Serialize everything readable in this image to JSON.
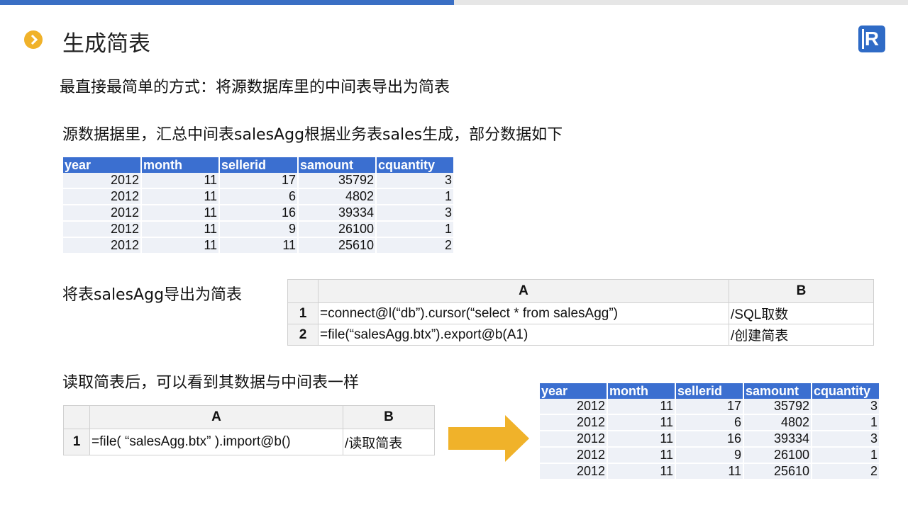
{
  "header": {
    "title": "生成简表",
    "progress": 0.5
  },
  "colors": {
    "accent": "#3a6fc4",
    "bullet": "#f0b22a",
    "arrow": "#f0b22a",
    "table_header": "#3b6fd0"
  },
  "texts": {
    "intro": "最直接最简单的方式：将源数据库里的中间表导出为简表",
    "source_desc": "源数据据里，汇总中间表salesAgg根据业务表sales生成，部分数据如下",
    "export_desc": "将表salesAgg导出为简表",
    "read_desc": "读取简表后，可以看到其数据与中间表一样"
  },
  "source_table": {
    "columns": [
      "year",
      "month",
      "sellerid",
      "samount",
      "cquantity"
    ],
    "rows": [
      [
        "2012",
        "11",
        "17",
        "35792",
        "3"
      ],
      [
        "2012",
        "11",
        "6",
        "4802",
        "1"
      ],
      [
        "2012",
        "11",
        "16",
        "39334",
        "3"
      ],
      [
        "2012",
        "11",
        "9",
        "26100",
        "1"
      ],
      [
        "2012",
        "11",
        "11",
        "25610",
        "2"
      ]
    ]
  },
  "export_grid": {
    "col_a": "A",
    "col_b": "B",
    "rows": [
      {
        "num": "1",
        "a": "=connect@l(“db”).cursor(“select * from salesAgg”)",
        "b": "/SQL取数"
      },
      {
        "num": "2",
        "a": "=file(“salesAgg.btx”).export@b(A1)",
        "b": "/创建简表"
      }
    ]
  },
  "import_grid": {
    "col_a": "A",
    "col_b": "B",
    "rows": [
      {
        "num": "1",
        "a": "=file( “salesAgg.btx” ).import@b()",
        "b": "/读取简表"
      }
    ]
  },
  "result_table": {
    "columns": [
      "year",
      "month",
      "sellerid",
      "samount",
      "cquantity"
    ],
    "rows": [
      [
        "2012",
        "11",
        "17",
        "35792",
        "3"
      ],
      [
        "2012",
        "11",
        "6",
        "4802",
        "1"
      ],
      [
        "2012",
        "11",
        "16",
        "39334",
        "3"
      ],
      [
        "2012",
        "11",
        "9",
        "26100",
        "1"
      ],
      [
        "2012",
        "11",
        "11",
        "25610",
        "2"
      ]
    ]
  }
}
